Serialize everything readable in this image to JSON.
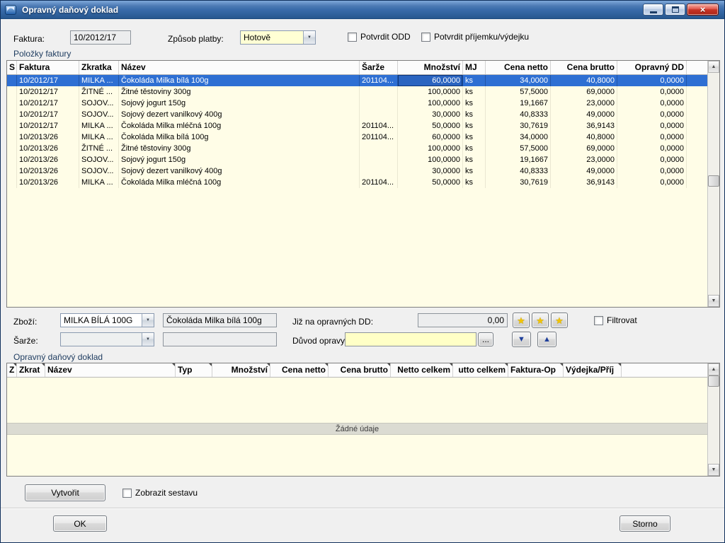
{
  "window": {
    "title": "Opravný daňový doklad"
  },
  "icons": {
    "combo_arrow": "▼",
    "star": "★",
    "down_arrow": "▼",
    "up_arrow": "▲",
    "scroll_up": "▲",
    "scroll_down": "▼",
    "close": "×"
  },
  "form": {
    "faktura_label": "Faktura:",
    "faktura_value": "10/2012/17",
    "platba_label": "Způsob platby:",
    "platba_value": "Hotově",
    "potvrdit_odd_label": "Potvrdit ODD",
    "potvrdit_prijemka_label": "Potvrdit příjemku/výdejku"
  },
  "items_table": {
    "group_label": "Položky faktury",
    "columns": [
      "S",
      "Faktura",
      "Zkratka",
      "Název",
      "Šarže",
      "Množství",
      "MJ",
      "Cena netto",
      "Cena brutto",
      "Opravný DD"
    ],
    "selected_row": 0,
    "focused_cell": 5,
    "rows": [
      [
        "",
        "10/2012/17",
        "MILKA ...",
        "Čokoláda Milka bílá 100g",
        "201104...",
        "60,0000",
        "ks",
        "34,0000",
        "40,8000",
        "0,0000"
      ],
      [
        "",
        "10/2012/17",
        "ŽITNÉ ...",
        "Žitné těstoviny 300g",
        "",
        "100,0000",
        "ks",
        "57,5000",
        "69,0000",
        "0,0000"
      ],
      [
        "",
        "10/2012/17",
        "SOJOV...",
        "Sojový jogurt 150g",
        "",
        "100,0000",
        "ks",
        "19,1667",
        "23,0000",
        "0,0000"
      ],
      [
        "",
        "10/2012/17",
        "SOJOV...",
        "Sojový dezert vanilkový 400g",
        "",
        "30,0000",
        "ks",
        "40,8333",
        "49,0000",
        "0,0000"
      ],
      [
        "",
        "10/2012/17",
        "MILKA ...",
        "Čokoláda Milka mléčná 100g",
        "201104...",
        "50,0000",
        "ks",
        "30,7619",
        "36,9143",
        "0,0000"
      ],
      [
        "",
        "10/2013/26",
        "MILKA ...",
        "Čokoláda Milka bílá 100g",
        "201104...",
        "60,0000",
        "ks",
        "34,0000",
        "40,8000",
        "0,0000"
      ],
      [
        "",
        "10/2013/26",
        "ŽITNÉ ...",
        "Žitné těstoviny 300g",
        "",
        "100,0000",
        "ks",
        "57,5000",
        "69,0000",
        "0,0000"
      ],
      [
        "",
        "10/2013/26",
        "SOJOV...",
        "Sojový jogurt 150g",
        "",
        "100,0000",
        "ks",
        "19,1667",
        "23,0000",
        "0,0000"
      ],
      [
        "",
        "10/2013/26",
        "SOJOV...",
        "Sojový dezert vanilkový 400g",
        "",
        "30,0000",
        "ks",
        "40,8333",
        "49,0000",
        "0,0000"
      ],
      [
        "",
        "10/2013/26",
        "MILKA ...",
        "Čokoláda Milka mléčná 100g",
        "201104...",
        "50,0000",
        "ks",
        "30,7619",
        "36,9143",
        "0,0000"
      ]
    ]
  },
  "detail": {
    "zbozi_label": "Zboží:",
    "zbozi_value": "MILKA BÍLÁ 100G",
    "zbozi_name": "Čokoláda Milka bílá 100g",
    "jiz_label": "Již na opravných DD:",
    "jiz_value": "0,00",
    "filtrovat_label": "Filtrovat",
    "sarze_label": "Šarže:",
    "sarze_value": "",
    "sarze_name": "",
    "duvod_label": "Důvod opravy:",
    "duvod_value": "",
    "ellipsis_button": "..."
  },
  "odd_table": {
    "group_label": "Opravný daňový doklad",
    "columns": [
      "Z",
      "Zkrat",
      "Název",
      "Typ",
      "Množství",
      "Cena netto",
      "Cena brutto",
      "Netto celkem",
      "utto celkem",
      "Faktura-Op",
      "Výdejka/Příj"
    ],
    "empty_text": "Žádné údaje"
  },
  "footer": {
    "vytvorit": "Vytvořit",
    "zobrazit_sestavu": "Zobrazit sestavu",
    "ok": "OK",
    "storno": "Storno"
  },
  "colors": {
    "selection": "#2e6fd3",
    "table_background": "#fffde7",
    "titlebar_blue": "#3a6cab",
    "field_yellow": "#ffffc6"
  }
}
